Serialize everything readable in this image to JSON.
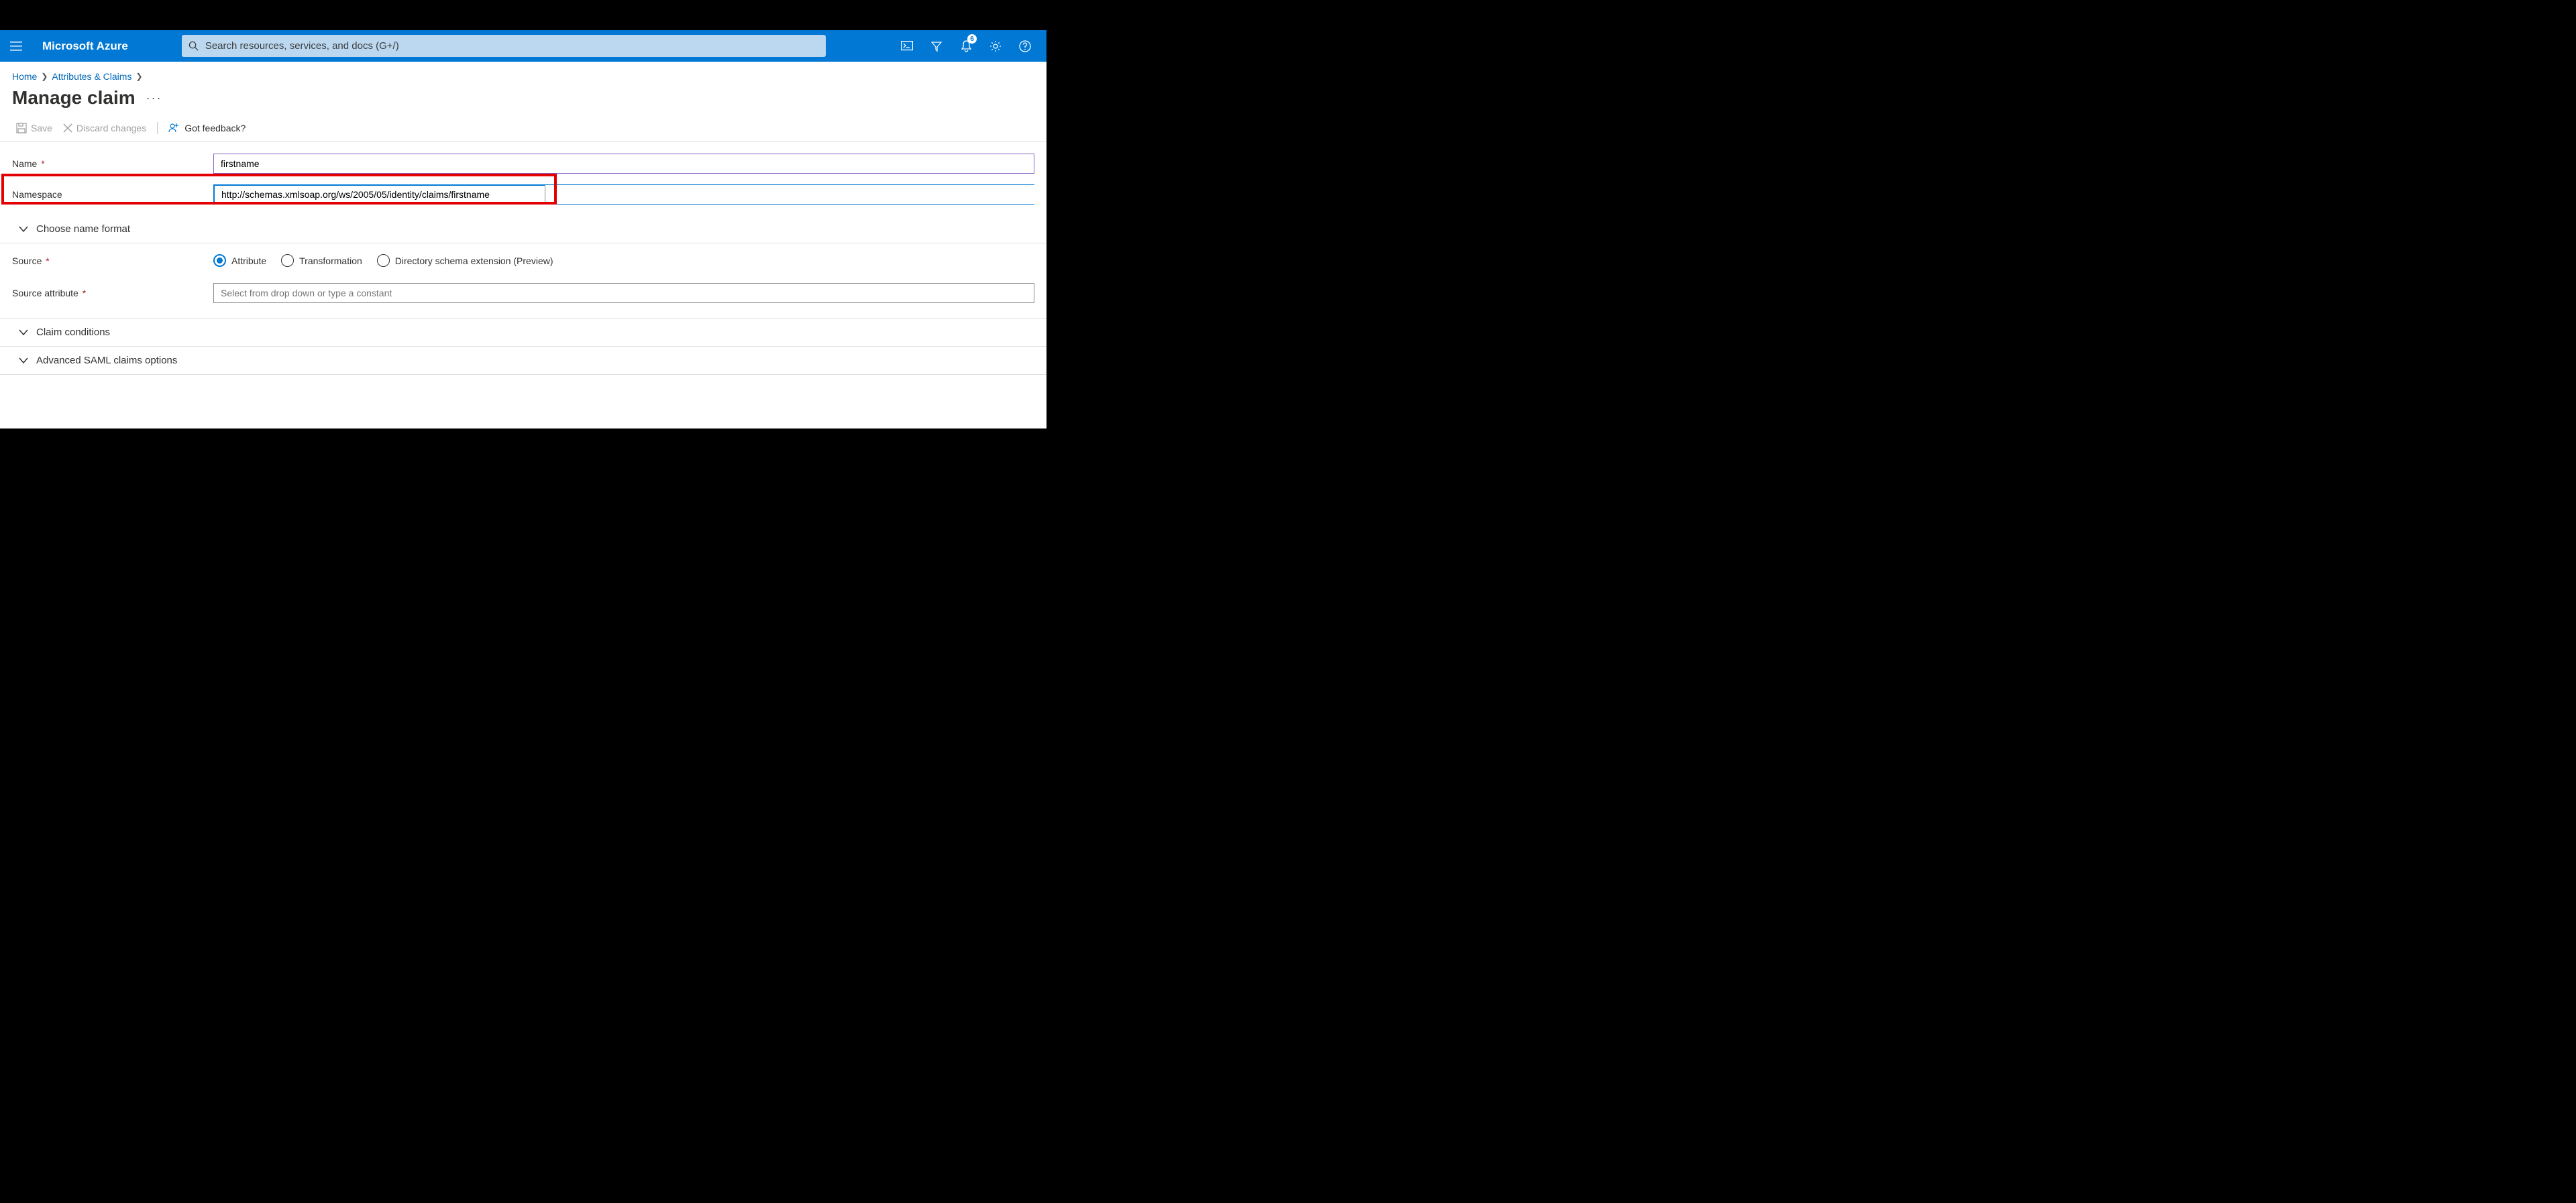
{
  "topbar": {
    "brand": "Microsoft Azure",
    "search_placeholder": "Search resources, services, and docs (G+/)",
    "notification_count": "6"
  },
  "breadcrumb": {
    "items": [
      "Home",
      "Attributes & Claims"
    ]
  },
  "page": {
    "title": "Manage claim"
  },
  "toolbar": {
    "save": "Save",
    "discard": "Discard changes",
    "feedback": "Got feedback?"
  },
  "form": {
    "name_label": "Name",
    "name_value": "firstname",
    "namespace_label": "Namespace",
    "namespace_value": "http://schemas.xmlsoap.org/ws/2005/05/identity/claims/firstname",
    "choose_name_format": "Choose name format",
    "source_label": "Source",
    "source_options": {
      "attribute": "Attribute",
      "transformation": "Transformation",
      "directory": "Directory schema extension (Preview)"
    },
    "source_attribute_label": "Source attribute",
    "source_attribute_placeholder": "Select from drop down or type a constant",
    "claim_conditions": "Claim conditions",
    "advanced_saml": "Advanced SAML claims options"
  }
}
